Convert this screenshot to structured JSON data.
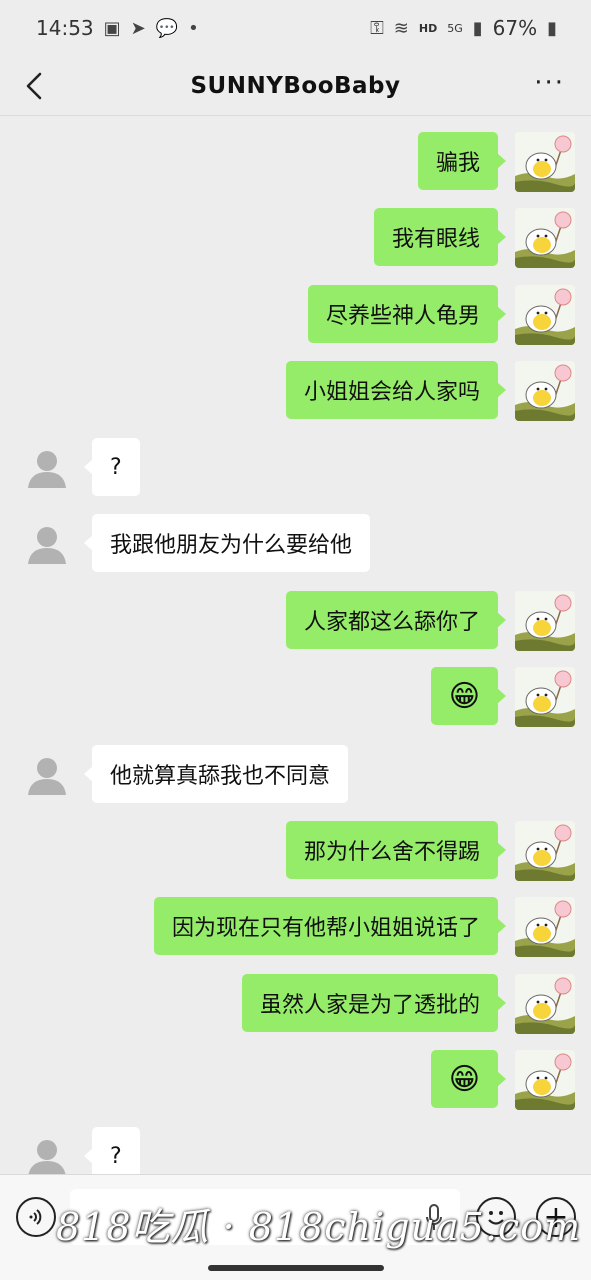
{
  "status": {
    "time": "14:53",
    "network": "HD",
    "signal": "5G",
    "battery": "67%"
  },
  "header": {
    "title": "SUNNYBooBaby"
  },
  "messages": [
    {
      "side": "right",
      "text": "骗我"
    },
    {
      "side": "right",
      "text": "我有眼线"
    },
    {
      "side": "right",
      "text": "尽养些神人龟男"
    },
    {
      "side": "right",
      "text": "小姐姐会给人家吗"
    },
    {
      "side": "left",
      "text": "?"
    },
    {
      "side": "left",
      "text": "我跟他朋友为什么要给他"
    },
    {
      "side": "right",
      "text": "人家都这么舔你了"
    },
    {
      "side": "right",
      "text": "😁"
    },
    {
      "side": "left",
      "text": "他就算真舔我也不同意"
    },
    {
      "side": "right",
      "text": "那为什么舍不得踢"
    },
    {
      "side": "right",
      "text": "因为现在只有他帮小姐姐说话了"
    },
    {
      "side": "right",
      "text": "虽然人家是为了透批的"
    },
    {
      "side": "right",
      "text": "😁"
    },
    {
      "side": "left",
      "text": "?"
    }
  ],
  "watermark": "818吃瓜 · 818chigua5.com",
  "icons": {
    "back": "chevron-left-icon",
    "more": "more-dots-icon",
    "voice": "voice-icon",
    "mic": "mic-icon",
    "emoji": "emoji-icon",
    "plus": "plus-icon"
  },
  "colors": {
    "sent_bubble": "#95ec69",
    "received_bubble": "#ffffff",
    "background": "#ededed"
  }
}
